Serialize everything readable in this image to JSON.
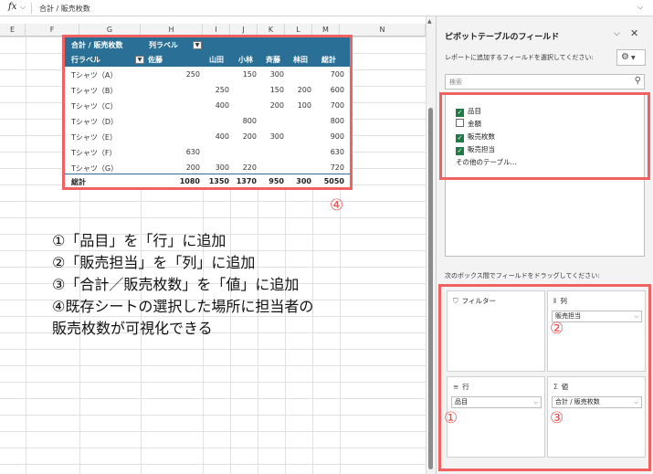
{
  "formula_bar": {
    "fx": "fx",
    "content": "合計 / 販売枚数"
  },
  "sheet": {
    "columns": [
      "E",
      "F",
      "G",
      "H",
      "I",
      "J",
      "K",
      "L",
      "M",
      "N"
    ]
  },
  "pivot": {
    "header1": {
      "value_label": "合計 / 販売枚数",
      "col_label": "列ラベル"
    },
    "header2": {
      "row_label": "行ラベル",
      "people": [
        "佐藤",
        "山田",
        "小林",
        "斉藤",
        "林田"
      ],
      "total": "総計"
    },
    "rows": [
      {
        "label": "Tシャツ（A）",
        "values": [
          "250",
          "",
          "150",
          "300",
          "",
          "700"
        ]
      },
      {
        "label": "Tシャツ（B）",
        "values": [
          "",
          "250",
          "",
          "150",
          "200",
          "600"
        ]
      },
      {
        "label": "Tシャツ（C）",
        "values": [
          "",
          "400",
          "",
          "200",
          "100",
          "700"
        ]
      },
      {
        "label": "Tシャツ（D）",
        "values": [
          "",
          "",
          "800",
          "",
          "",
          "800"
        ]
      },
      {
        "label": "Tシャツ（E）",
        "values": [
          "",
          "400",
          "200",
          "300",
          "",
          "900"
        ]
      },
      {
        "label": "Tシャツ（F）",
        "values": [
          "630",
          "",
          "",
          "",
          "",
          "630"
        ]
      },
      {
        "label": "Tシャツ（G）",
        "values": [
          "200",
          "300",
          "220",
          "",
          "",
          "720"
        ]
      }
    ],
    "total_row": {
      "label": "総計",
      "values": [
        "1080",
        "1350",
        "1370",
        "950",
        "300",
        "5050"
      ]
    }
  },
  "annotations": {
    "mark4": "④",
    "notes": [
      "①「品目」を「行」に追加",
      "②「販売担当」を「列」に追加",
      "③「合計／販売枚数」を「値」に追加",
      "④既存シートの選択した場所に担当者の",
      "販売枚数が可視化できる"
    ],
    "mark1": "①",
    "mark2": "②",
    "mark3": "③"
  },
  "pane": {
    "title": "ピボットテーブルのフィールド",
    "subtitle": "レポートに追加するフィールドを選択してください:",
    "search_placeholder": "検索",
    "fields": [
      {
        "label": "品目",
        "checked": true
      },
      {
        "label": "金額",
        "checked": false
      },
      {
        "label": "販売枚数",
        "checked": true
      },
      {
        "label": "販売担当",
        "checked": true
      }
    ],
    "more_tables": "その他のテーブル...",
    "drag_note": "次のボックス間でフィールドをドラッグしてください:",
    "areas": {
      "filter": {
        "title": "フィルター"
      },
      "columns": {
        "title": "列",
        "value": "販売担当"
      },
      "rows": {
        "title": "行",
        "value": "品目"
      },
      "values": {
        "title": "値",
        "value": "合計 / 販売枚数"
      }
    }
  },
  "colors": {
    "pivot_header": "#2a6f95",
    "highlight": "#f06262",
    "check": "#1f7a45"
  }
}
